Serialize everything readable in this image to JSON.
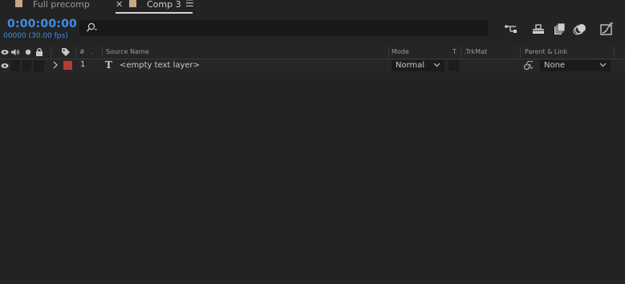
{
  "tabs": [
    {
      "label": "Full precomp",
      "active": false
    },
    {
      "label": "Comp 3",
      "active": true
    }
  ],
  "timecode": "0:00:00:00",
  "frame_info": "00000 (30.00 fps)",
  "search": {
    "placeholder": ""
  },
  "columns": {
    "label": "",
    "number": "#",
    "source_name": "Source Name",
    "mode": "Mode",
    "t": "T",
    "trkmat": ".TrkMat",
    "parent": "Parent & Link"
  },
  "layers": [
    {
      "number": "1",
      "type_icon": "T",
      "name": "<empty text layer>",
      "color": "#b53b3b",
      "mode": "Normal",
      "parent": "None"
    }
  ],
  "colors": {
    "accent": "#3d8fe6",
    "background": "#232323",
    "label_swatch": "#c4a784"
  }
}
